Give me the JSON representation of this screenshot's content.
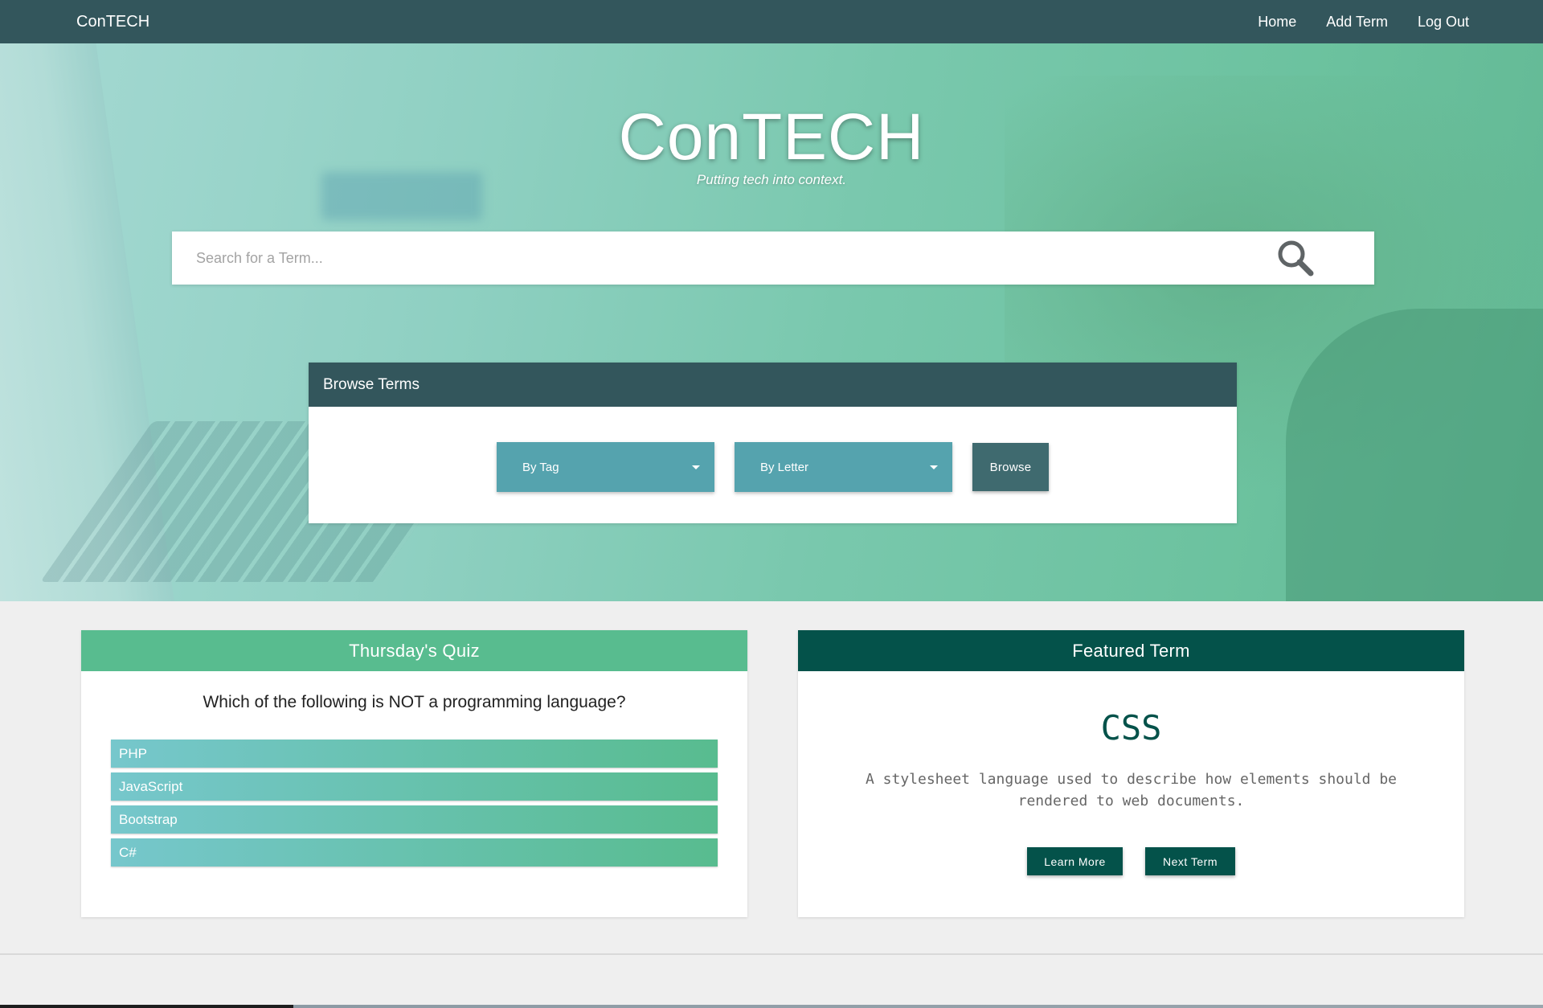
{
  "navbar": {
    "brand": "ConTECH",
    "links": [
      "Home",
      "Add Term",
      "Log Out"
    ]
  },
  "hero": {
    "title": "ConTECH",
    "tagline": "Putting tech into context.",
    "search": {
      "placeholder": "Search for a Term...",
      "icon": "magnifier-icon"
    }
  },
  "browse": {
    "header": "Browse Terms",
    "tag_select": "By Tag",
    "letter_select": "By Letter",
    "button": "Browse"
  },
  "quiz": {
    "title": "Thursday's Quiz",
    "question": "Which of the following is NOT a programming language?",
    "options": [
      "PHP",
      "JavaScript",
      "Bootstrap",
      "C#"
    ]
  },
  "featured": {
    "title": "Featured Term",
    "term": "CSS",
    "definition": "A stylesheet language used to describe how elements should be rendered to web documents.",
    "learn_more": "Learn More",
    "next_term": "Next Term"
  },
  "colors": {
    "navbar": "#33565c",
    "quiz_header": "#58bc8f",
    "featured_header": "#04524a",
    "select_bg": "#55a3ae"
  }
}
